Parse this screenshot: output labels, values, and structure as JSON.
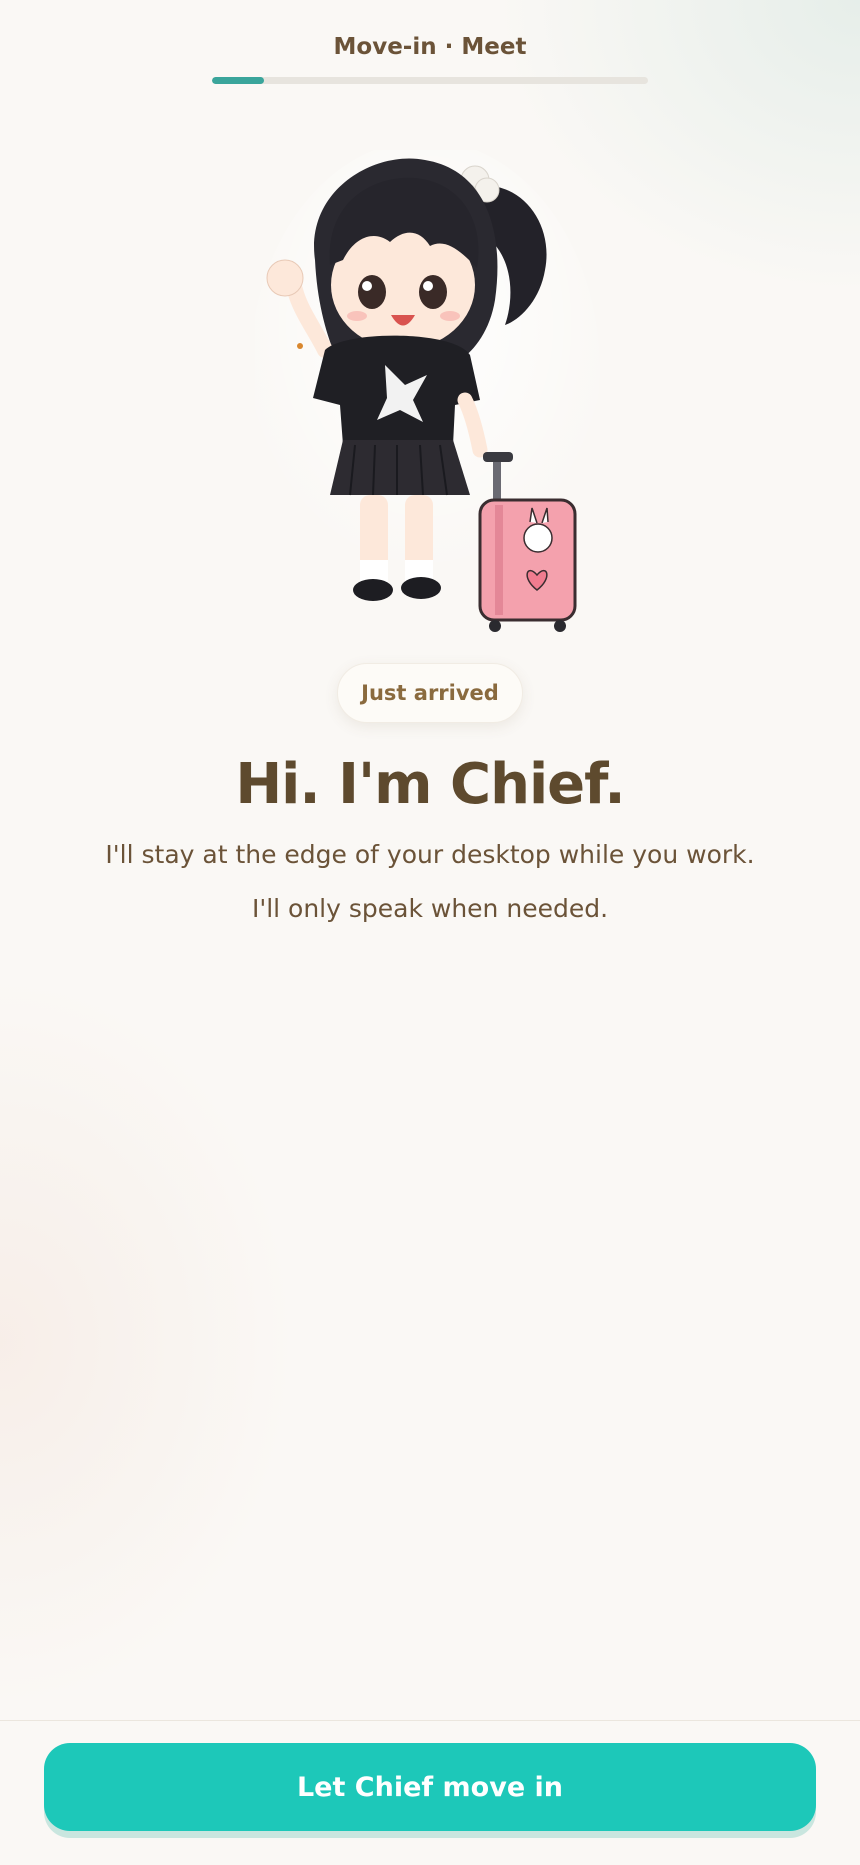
{
  "header": {
    "step_title": "Move-in · Meet",
    "progress_percent": 12
  },
  "badge": {
    "label": "Just arrived"
  },
  "intro": {
    "headline": "Hi. I'm Chief.",
    "line1": "I'll stay at the edge of your desktop while you work.",
    "line2": "I'll only speak when needed."
  },
  "footer": {
    "cta_label": "Let Chief move in"
  },
  "colors": {
    "accent": "#1dc8b9",
    "progress": "#3aa59b",
    "text_brown": "#5e4a2e",
    "background": "#faf8f5"
  },
  "illustration": {
    "name": "chief-mascot-with-suitcase"
  }
}
